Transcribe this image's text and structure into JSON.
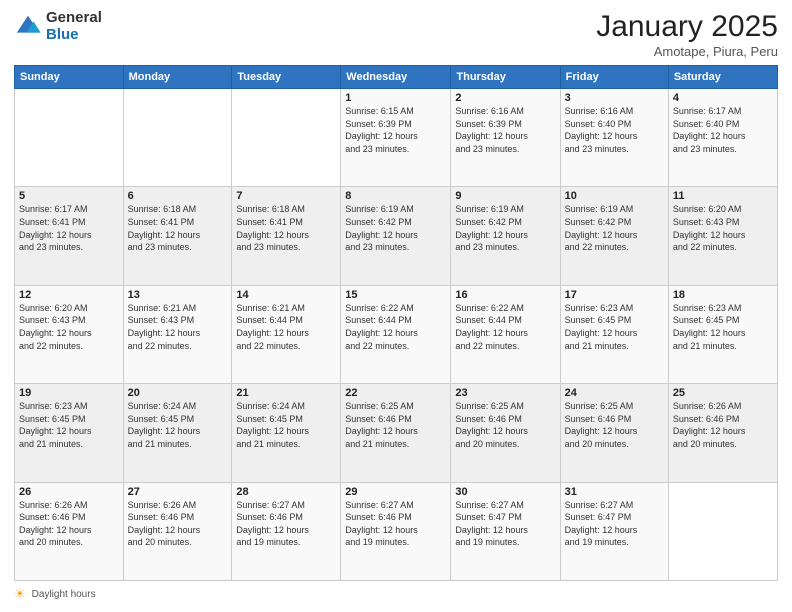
{
  "logo": {
    "general": "General",
    "blue": "Blue"
  },
  "header": {
    "month": "January 2025",
    "location": "Amotape, Piura, Peru"
  },
  "weekdays": [
    "Sunday",
    "Monday",
    "Tuesday",
    "Wednesday",
    "Thursday",
    "Friday",
    "Saturday"
  ],
  "weeks": [
    [
      {
        "day": "",
        "info": ""
      },
      {
        "day": "",
        "info": ""
      },
      {
        "day": "",
        "info": ""
      },
      {
        "day": "1",
        "info": "Sunrise: 6:15 AM\nSunset: 6:39 PM\nDaylight: 12 hours\nand 23 minutes."
      },
      {
        "day": "2",
        "info": "Sunrise: 6:16 AM\nSunset: 6:39 PM\nDaylight: 12 hours\nand 23 minutes."
      },
      {
        "day": "3",
        "info": "Sunrise: 6:16 AM\nSunset: 6:40 PM\nDaylight: 12 hours\nand 23 minutes."
      },
      {
        "day": "4",
        "info": "Sunrise: 6:17 AM\nSunset: 6:40 PM\nDaylight: 12 hours\nand 23 minutes."
      }
    ],
    [
      {
        "day": "5",
        "info": "Sunrise: 6:17 AM\nSunset: 6:41 PM\nDaylight: 12 hours\nand 23 minutes."
      },
      {
        "day": "6",
        "info": "Sunrise: 6:18 AM\nSunset: 6:41 PM\nDaylight: 12 hours\nand 23 minutes."
      },
      {
        "day": "7",
        "info": "Sunrise: 6:18 AM\nSunset: 6:41 PM\nDaylight: 12 hours\nand 23 minutes."
      },
      {
        "day": "8",
        "info": "Sunrise: 6:19 AM\nSunset: 6:42 PM\nDaylight: 12 hours\nand 23 minutes."
      },
      {
        "day": "9",
        "info": "Sunrise: 6:19 AM\nSunset: 6:42 PM\nDaylight: 12 hours\nand 23 minutes."
      },
      {
        "day": "10",
        "info": "Sunrise: 6:19 AM\nSunset: 6:42 PM\nDaylight: 12 hours\nand 22 minutes."
      },
      {
        "day": "11",
        "info": "Sunrise: 6:20 AM\nSunset: 6:43 PM\nDaylight: 12 hours\nand 22 minutes."
      }
    ],
    [
      {
        "day": "12",
        "info": "Sunrise: 6:20 AM\nSunset: 6:43 PM\nDaylight: 12 hours\nand 22 minutes."
      },
      {
        "day": "13",
        "info": "Sunrise: 6:21 AM\nSunset: 6:43 PM\nDaylight: 12 hours\nand 22 minutes."
      },
      {
        "day": "14",
        "info": "Sunrise: 6:21 AM\nSunset: 6:44 PM\nDaylight: 12 hours\nand 22 minutes."
      },
      {
        "day": "15",
        "info": "Sunrise: 6:22 AM\nSunset: 6:44 PM\nDaylight: 12 hours\nand 22 minutes."
      },
      {
        "day": "16",
        "info": "Sunrise: 6:22 AM\nSunset: 6:44 PM\nDaylight: 12 hours\nand 22 minutes."
      },
      {
        "day": "17",
        "info": "Sunrise: 6:23 AM\nSunset: 6:45 PM\nDaylight: 12 hours\nand 21 minutes."
      },
      {
        "day": "18",
        "info": "Sunrise: 6:23 AM\nSunset: 6:45 PM\nDaylight: 12 hours\nand 21 minutes."
      }
    ],
    [
      {
        "day": "19",
        "info": "Sunrise: 6:23 AM\nSunset: 6:45 PM\nDaylight: 12 hours\nand 21 minutes."
      },
      {
        "day": "20",
        "info": "Sunrise: 6:24 AM\nSunset: 6:45 PM\nDaylight: 12 hours\nand 21 minutes."
      },
      {
        "day": "21",
        "info": "Sunrise: 6:24 AM\nSunset: 6:45 PM\nDaylight: 12 hours\nand 21 minutes."
      },
      {
        "day": "22",
        "info": "Sunrise: 6:25 AM\nSunset: 6:46 PM\nDaylight: 12 hours\nand 21 minutes."
      },
      {
        "day": "23",
        "info": "Sunrise: 6:25 AM\nSunset: 6:46 PM\nDaylight: 12 hours\nand 20 minutes."
      },
      {
        "day": "24",
        "info": "Sunrise: 6:25 AM\nSunset: 6:46 PM\nDaylight: 12 hours\nand 20 minutes."
      },
      {
        "day": "25",
        "info": "Sunrise: 6:26 AM\nSunset: 6:46 PM\nDaylight: 12 hours\nand 20 minutes."
      }
    ],
    [
      {
        "day": "26",
        "info": "Sunrise: 6:26 AM\nSunset: 6:46 PM\nDaylight: 12 hours\nand 20 minutes."
      },
      {
        "day": "27",
        "info": "Sunrise: 6:26 AM\nSunset: 6:46 PM\nDaylight: 12 hours\nand 20 minutes."
      },
      {
        "day": "28",
        "info": "Sunrise: 6:27 AM\nSunset: 6:46 PM\nDaylight: 12 hours\nand 19 minutes."
      },
      {
        "day": "29",
        "info": "Sunrise: 6:27 AM\nSunset: 6:46 PM\nDaylight: 12 hours\nand 19 minutes."
      },
      {
        "day": "30",
        "info": "Sunrise: 6:27 AM\nSunset: 6:47 PM\nDaylight: 12 hours\nand 19 minutes."
      },
      {
        "day": "31",
        "info": "Sunrise: 6:27 AM\nSunset: 6:47 PM\nDaylight: 12 hours\nand 19 minutes."
      },
      {
        "day": "",
        "info": ""
      }
    ]
  ],
  "footer": {
    "daylight_label": "Daylight hours"
  }
}
